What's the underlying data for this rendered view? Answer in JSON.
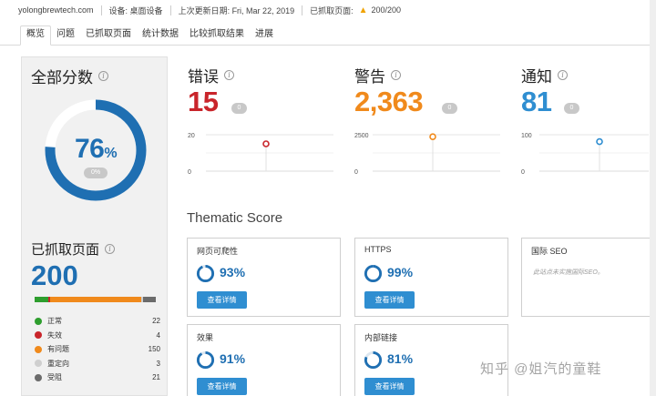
{
  "topbar": {
    "domain": "yolongbrewtech.com",
    "device": "设备: 桌面设备",
    "updated": "上次更新日期: Fri, Mar 22, 2019",
    "crawled_label": "已抓取页面:",
    "crawled_value": "200/200"
  },
  "tabs": [
    "概览",
    "问题",
    "已抓取页面",
    "统计数据",
    "比较抓取结果",
    "进展"
  ],
  "site_health": {
    "title": "全部分数",
    "value": "76",
    "unit": "%",
    "percent": 76,
    "delta": "0%"
  },
  "crawled": {
    "title": "已抓取页面",
    "count": "200",
    "legend": [
      {
        "label": "正常",
        "value": 22,
        "color": "#2e9e2e"
      },
      {
        "label": "失效",
        "value": 4,
        "color": "#c9252b"
      },
      {
        "label": "有问题",
        "value": 150,
        "color": "#f08a1c"
      },
      {
        "label": "重定向",
        "value": 3,
        "color": "#cfcfcf"
      },
      {
        "label": "受阻",
        "value": 21,
        "color": "#6b6b6b"
      }
    ]
  },
  "metrics": [
    {
      "title": "错误",
      "value": "15",
      "delta": "0",
      "color": "#c9252b",
      "axis_top": "20",
      "axis_bottom": "0",
      "point": 15,
      "max": 20
    },
    {
      "title": "警告",
      "value": "2,363",
      "delta": "0",
      "color": "#f08a1c",
      "axis_top": "2500",
      "axis_bottom": "0",
      "point": 2363,
      "max": 2500
    },
    {
      "title": "通知",
      "value": "81",
      "delta": "0",
      "color": "#2f8ed1",
      "axis_top": "100",
      "axis_bottom": "0",
      "point": 81,
      "max": 100
    }
  ],
  "thematic": {
    "title": "Thematic Score",
    "cards": [
      {
        "title": "网页可爬性",
        "value": "93%",
        "percent": 93,
        "button": "查看详情"
      },
      {
        "title": "HTTPS",
        "value": "99%",
        "percent": 99,
        "button": "查看详情"
      },
      {
        "title": "国际 SEO",
        "note": "此站点未实施国际SEO。"
      },
      {
        "title": "效果",
        "value": "91%",
        "percent": 91,
        "button": "查看详情"
      },
      {
        "title": "内部链接",
        "value": "81%",
        "percent": 81,
        "button": "查看详情"
      }
    ]
  },
  "watermark": "知乎 @姐汽的童鞋"
}
